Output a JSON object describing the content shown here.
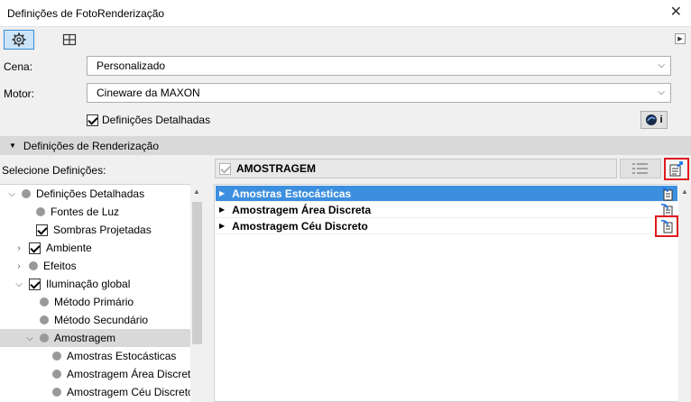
{
  "window": {
    "title": "Definições de FotoRenderização",
    "close_glyph": "✕"
  },
  "toolbar": {
    "buttons": [
      {
        "icon": "gear-icon",
        "active": true
      },
      {
        "icon": "grid-view-icon",
        "active": false
      }
    ],
    "expand_glyph": "▶"
  },
  "scene": {
    "label": "Cena:",
    "value": "Personalizado"
  },
  "engine": {
    "label": "Motor:",
    "value": "Cineware da MAXON"
  },
  "detailed_settings": {
    "label": "Definições Detalhadas",
    "checked": true
  },
  "info_button": {
    "glyph": "i",
    "icon": "cinema4d-logo-icon"
  },
  "render_section": {
    "title": "Definições de Renderização"
  },
  "select_label": "Selecione Definições:",
  "tree": {
    "items": [
      {
        "label": "Definições Detalhadas",
        "level": 0,
        "expander": "open",
        "marker": "dot",
        "selected": false
      },
      {
        "label": "Fontes de Luz",
        "level": 1,
        "expander": "none",
        "marker": "dot",
        "selected": false
      },
      {
        "label": "Sombras Projetadas",
        "level": 1,
        "expander": "none",
        "marker": "check",
        "selected": false
      },
      {
        "label": "Ambiente",
        "level": 1,
        "expander": "closed",
        "marker": "check",
        "selected": false
      },
      {
        "label": "Efeitos",
        "level": 1,
        "expander": "closed",
        "marker": "dot",
        "selected": false
      },
      {
        "label": "Iluminação global",
        "level": 1,
        "expander": "open",
        "marker": "check",
        "selected": false
      },
      {
        "label": "Método Primário",
        "level": 2,
        "expander": "none",
        "marker": "dot",
        "selected": false
      },
      {
        "label": "Método Secundário",
        "level": 2,
        "expander": "none",
        "marker": "dot",
        "selected": false
      },
      {
        "label": "Amostragem",
        "level": 2,
        "expander": "open",
        "marker": "dot",
        "selected": true
      },
      {
        "label": "Amostras Estocásticas",
        "level": 3,
        "expander": "none",
        "marker": "dot",
        "selected": false
      },
      {
        "label": "Amostragem Área Discreta",
        "level": 3,
        "expander": "none",
        "marker": "dot",
        "selected": false
      },
      {
        "label": "Amostragem Céu Discreto",
        "level": 3,
        "expander": "none",
        "marker": "dot",
        "selected": false
      }
    ]
  },
  "right_panel": {
    "header": "AMOSTRAGEM",
    "rows": [
      {
        "label": "Amostras Estocásticas",
        "highlighted": true
      },
      {
        "label": "Amostragem Área Discreta",
        "highlighted": false
      },
      {
        "label": "Amostragem Céu Discreto",
        "highlighted": false
      }
    ]
  },
  "colors": {
    "accent": "#3c8fdf",
    "highlight_box": "#e0191c",
    "selected_tree": "#d9d9d9"
  }
}
